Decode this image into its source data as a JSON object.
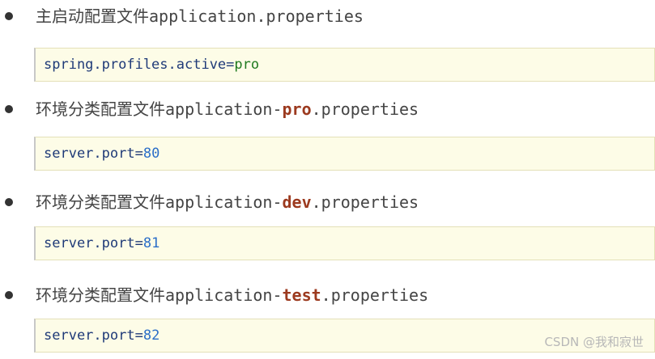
{
  "sections": [
    {
      "heading_prefix": "主启动配置文件application",
      "heading_highlight": "",
      "heading_suffix": ".properties",
      "code_key": "spring.profiles.active=",
      "code_value": "pro"
    },
    {
      "heading_prefix": "环境分类配置文件application-",
      "heading_highlight": "pro",
      "heading_suffix": ".properties",
      "code_key": "server.port=",
      "code_value": "80"
    },
    {
      "heading_prefix": "环境分类配置文件application-",
      "heading_highlight": "dev",
      "heading_suffix": ".properties",
      "code_key": "server.port=",
      "code_value": "81"
    },
    {
      "heading_prefix": "环境分类配置文件application-",
      "heading_highlight": "test",
      "heading_suffix": ".properties",
      "code_key": "server.port=",
      "code_value": "82"
    }
  ],
  "watermark": "CSDN @我和寂世",
  "colors": {
    "highlight": "#9c3a1f",
    "code_key": "#1f3a78",
    "code_string": "#1f7a1f",
    "code_number": "#2b6ec8",
    "code_background": "#fdfce7"
  }
}
